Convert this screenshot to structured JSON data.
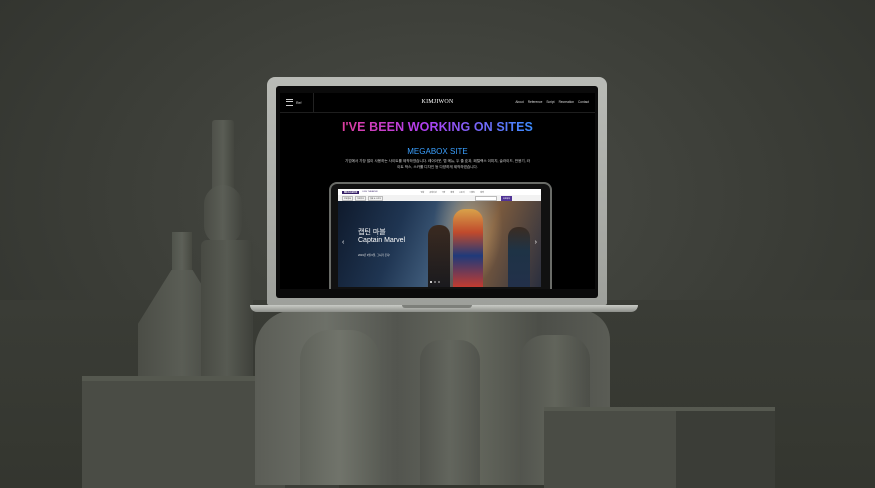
{
  "site": {
    "menu_label": "Ref",
    "logo": "KIMJIWON",
    "nav_links": [
      "About",
      "Reference",
      "Script",
      "Recreation",
      "Contact"
    ]
  },
  "headline": "I'VE BEEN WORKING ON SITES",
  "section": {
    "title": "MEGABOX SITE",
    "description": "기업에서 가장 많이 사용하는 사이트를 제작하였습니다. 레이아웃, 탭 메뉴, 두 줄 효과, 패럴랙스 이미지, 슬라이드, 반응기, 라이트 박스, 스카롤 디자인 등 다양하게 제작하였습니다."
  },
  "megabox": {
    "logo": "MEGABOX",
    "tagline": "LIFE THEATER",
    "menu": [
      "영화",
      "큐레이션",
      "극장",
      "예매",
      "스토어",
      "이벤트",
      "혜택"
    ],
    "subnav": [
      "전체영화",
      "큐레이션",
      "영화 & 스토어"
    ],
    "book_button": "빠른예매",
    "hero_title_ko": "캡틴 마블",
    "hero_title_en": "Captain Marvel",
    "hero_sub": "2019년 3월 6일, 그녀가 온다!"
  },
  "colors": {
    "accent_blue": "#3aa0ff",
    "headline_gradient": [
      "#ff3d5f",
      "#b23ef0",
      "#3d8cff",
      "#4fc3ff"
    ],
    "megabox_purple": "#351f66"
  }
}
